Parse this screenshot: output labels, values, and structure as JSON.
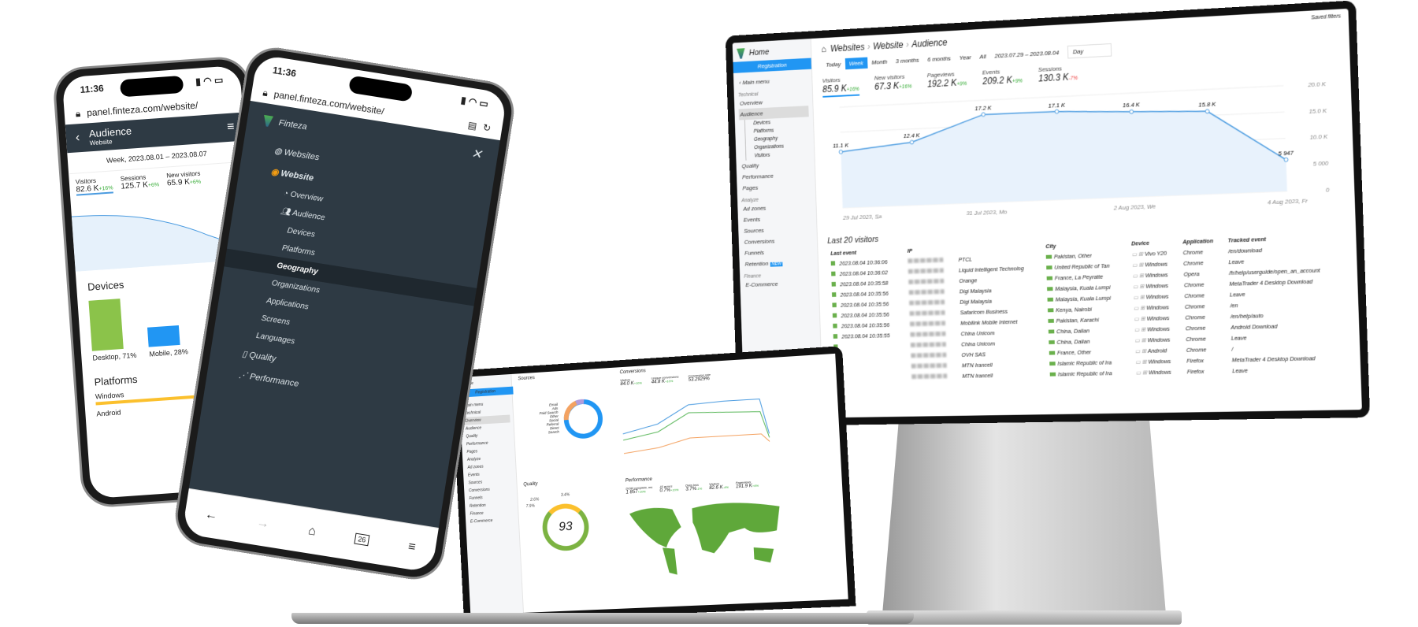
{
  "monitor": {
    "saved_filters": "Saved filters",
    "sidebar": {
      "home": "Home",
      "registration": "Registration",
      "main_menu": "Main menu",
      "sections": [
        {
          "label": "Technical",
          "items": [
            {
              "label": "Overview"
            },
            {
              "label": "Audience",
              "active": true,
              "sub": [
                "Devices",
                "Platforms",
                "Geography",
                "Organizations",
                "Visitors"
              ]
            },
            {
              "label": "Quality"
            },
            {
              "label": "Performance"
            },
            {
              "label": "Pages"
            }
          ]
        },
        {
          "label": "Analyze",
          "items": [
            {
              "label": "Ad zones"
            },
            {
              "label": "Events"
            },
            {
              "label": "Sources"
            },
            {
              "label": "Conversions"
            },
            {
              "label": "Funnels"
            },
            {
              "label": "Retention",
              "badge": "NEW"
            }
          ]
        },
        {
          "label": "Finance",
          "items": [
            {
              "label": "E-Commerce"
            }
          ]
        }
      ]
    },
    "breadcrumb": [
      "Websites",
      "Website",
      "Audience"
    ],
    "periods": [
      "Today",
      "Week",
      "Month",
      "3 months",
      "6 months",
      "Year",
      "All"
    ],
    "active_period": "Week",
    "date_range": "2023.07.29 – 2023.08.04",
    "granularity": "Day",
    "kpis": [
      {
        "label": "Visitors",
        "value": "85.9 K",
        "delta": "+16%",
        "dir": "up"
      },
      {
        "label": "New visitors",
        "value": "67.3 K",
        "delta": "+16%",
        "dir": "up"
      },
      {
        "label": "Pageviews",
        "value": "192.2 K",
        "delta": "+9%",
        "dir": "up"
      },
      {
        "label": "Events",
        "value": "209.2 K",
        "delta": "+9%",
        "dir": "up"
      },
      {
        "label": "Sessions",
        "value": "130.3 K",
        "delta": "-7%",
        "dir": "down"
      }
    ],
    "chart_data": {
      "type": "area",
      "x": [
        "29 Jul 2023",
        "30 Jul 2023",
        "31 Jul 2023",
        "1 Aug 2023",
        "2 Aug 2023",
        "3 Aug 2023",
        "4 Aug 2023"
      ],
      "values": [
        11100,
        12400,
        17200,
        17100,
        16400,
        15800,
        5947
      ],
      "data_labels": [
        "11.1 K",
        "12.4 K",
        "17.2 K",
        "17.1 K",
        "16.4 K",
        "15.8 K",
        "5 947"
      ],
      "x_tick_labels": [
        "29 Jul 2023, Sa",
        "31 Jul 2023, Mo",
        "2 Aug 2023, We",
        "4 Aug 2023, Fr"
      ],
      "y_tick_labels": [
        "0",
        "5 000",
        "10.0 K",
        "15.0 K",
        "20.0 K"
      ],
      "ylim": [
        0,
        20000
      ],
      "grid": true,
      "color": "#4a9be0"
    },
    "table": {
      "title": "Last 20 visitors",
      "columns": [
        "Last event",
        "IP",
        "",
        "City",
        "Device",
        "Application",
        "Tracked event"
      ],
      "rows": [
        {
          "time": "2023.08.04 10:36:06",
          "isp": "PTCL",
          "city": "Pakistan, Other",
          "device": "Vivo Y20",
          "app": "Chrome",
          "event": "/en/download"
        },
        {
          "time": "2023.08.04 10:36:02",
          "isp": "Liquid Intelligent Technolog",
          "city": "United Republic of Tan",
          "device": "Windows",
          "app": "Chrome",
          "event": "Leave"
        },
        {
          "time": "2023.08.04 10:35:58",
          "isp": "Orange",
          "city": "France, La Peyratte",
          "device": "Windows",
          "app": "Opera",
          "event": "/fr/help/userguide/open_an_account"
        },
        {
          "time": "2023.08.04 10:35:56",
          "isp": "Digi Malaysia",
          "city": "Malaysia, Kuala Lumpi",
          "device": "Windows",
          "app": "Chrome",
          "event": "MetaTrader 4 Desktop Download"
        },
        {
          "time": "2023.08.04 10:35:56",
          "isp": "Digi Malaysia",
          "city": "Malaysia, Kuala Lumpi",
          "device": "Windows",
          "app": "Chrome",
          "event": "Leave"
        },
        {
          "time": "2023.08.04 10:35:56",
          "isp": "Safaricom Business",
          "city": "Kenya, Nairobi",
          "device": "Windows",
          "app": "Chrome",
          "event": "/en"
        },
        {
          "time": "2023.08.04 10:35:56",
          "isp": "Mobilink Mobile Internet",
          "city": "Pakistan, Karachi",
          "device": "Windows",
          "app": "Chrome",
          "event": "/en/help/auto"
        },
        {
          "time": "2023.08.04 10:35:55",
          "isp": "China Unicom",
          "city": "China, Dalian",
          "device": "Windows",
          "app": "Chrome",
          "event": "Android Download"
        },
        {
          "time": "",
          "isp": "China Unicom",
          "city": "China, Dalian",
          "device": "Windows",
          "app": "Chrome",
          "event": "Leave"
        },
        {
          "time": "",
          "isp": "OVH SAS",
          "city": "France, Other",
          "device": "Android",
          "app": "Chrome",
          "event": "/"
        },
        {
          "time": "",
          "isp": "MTN Irancell",
          "city": "Islamic Republic of Ira",
          "device": "Windows",
          "app": "Firefox",
          "event": "MetaTrader 4 Desktop Download"
        },
        {
          "time": "",
          "isp": "MTN Irancell",
          "city": "Islamic Republic of Ira",
          "device": "Windows",
          "app": "Firefox",
          "event": "Leave"
        }
      ]
    }
  },
  "laptop": {
    "sidebar": [
      "Home",
      "Registration",
      "Main menu",
      "Technical",
      "Overview",
      "Audience",
      "Quality",
      "Performance",
      "Pages",
      "Analyze",
      "Ad zones",
      "Events",
      "Sources",
      "Conversions",
      "Funnels",
      "Retention",
      "Finance",
      "E-Commerce"
    ],
    "sources": {
      "title": "Sources",
      "labels": [
        "Email",
        "Ads",
        "Paid Search",
        "Other",
        "Social",
        "Referral",
        "Direct",
        "Search"
      ]
    },
    "conversions": {
      "title": "Conversions",
      "kpis": [
        {
          "label": "Visitors",
          "value": "84.0 K",
          "delta": "+10%"
        },
        {
          "label": "Unique conversions",
          "value": "44.8 K",
          "delta": "+10%"
        },
        {
          "label": "Conversion rate",
          "value": "53.2929%",
          "delta": ""
        }
      ]
    },
    "quality": {
      "title": "Quality",
      "score": "93",
      "labels": [
        "2.6%",
        "7.9%",
        "3.4%"
      ]
    },
    "performance": {
      "title": "Performance",
      "kpis": [
        {
          "label": "DOM complete, ms",
          "value": "1 857",
          "delta": "+10%"
        },
        {
          "label": "JS errors",
          "value": "0.7%",
          "delta": "+10%"
        },
        {
          "label": "Data loss",
          "value": "3.7%",
          "delta": "-1%"
        },
        {
          "label": "Visitors",
          "value": "82.6 K",
          "delta": "-4%"
        },
        {
          "label": "Pageviews",
          "value": "191.9 K",
          "delta": "+6%"
        }
      ]
    }
  },
  "phone1": {
    "time": "11:36",
    "url": "panel.finteza.com/website/",
    "title": "Audience",
    "subtitle": "Website",
    "period": "Week, 2023.08.01 – 2023.08.07",
    "kpis": [
      {
        "label": "Visitors",
        "value": "82.6 K",
        "delta": "+16%"
      },
      {
        "label": "Sessions",
        "value": "125.7 K",
        "delta": "+6%"
      },
      {
        "label": "New visitors",
        "value": "65.9 K",
        "delta": "+6%"
      }
    ],
    "devices_title": "Devices",
    "devices": [
      {
        "label": "Desktop, 71%",
        "share": 71,
        "color": "#8bc34a"
      },
      {
        "label": "Mobile, 28%",
        "share": 28,
        "color": "#2196f3"
      }
    ],
    "platforms_title": "Platforms",
    "platforms": [
      "Windows",
      "Android"
    ]
  },
  "phone2": {
    "time": "11:36",
    "url": "panel.finteza.com/website/",
    "brand": "Finteza",
    "menu": {
      "websites": "Websites",
      "website": "Website",
      "overview": "Overview",
      "audience": "Audience",
      "audience_sub": [
        "Devices",
        "Platforms",
        "Geography",
        "Organizations",
        "Applications",
        "Screens",
        "Languages"
      ],
      "active": "Geography",
      "quality": "Quality",
      "performance": "Performance"
    },
    "tabs_count": "26"
  }
}
